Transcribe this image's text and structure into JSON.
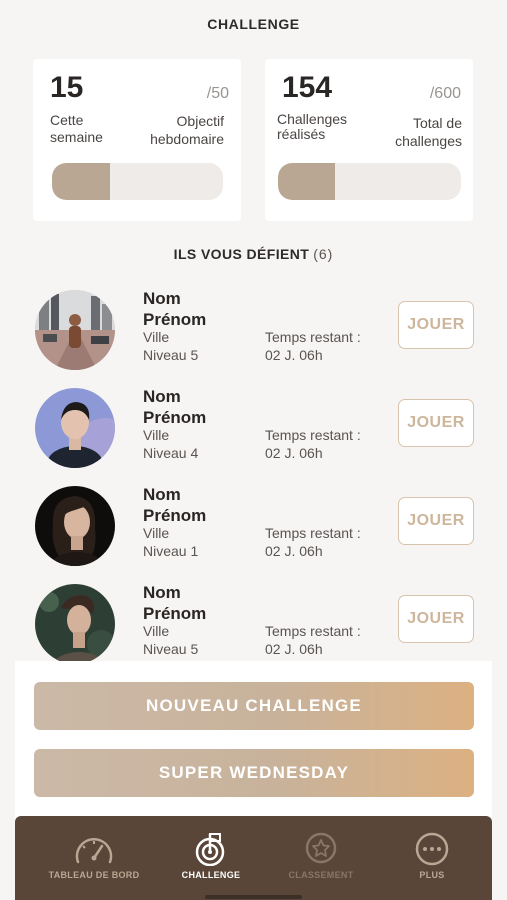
{
  "header": {
    "title": "CHALLENGE"
  },
  "stats": [
    {
      "value": "15",
      "max": "/50",
      "label_left": "Cette\nsemaine",
      "label_right": "Objectif\nhebdomaire",
      "progress": 0.34
    },
    {
      "value": "154",
      "max": "/600",
      "label_left": "Challenges\nréalisés",
      "label_right": "Total de\nchallenges",
      "progress": 0.31
    }
  ],
  "section": {
    "title": "ILS VOUS DÉFIENT",
    "count": "(6)"
  },
  "challengers": [
    {
      "name": "Nom\nPrénom",
      "city": "Ville",
      "level": "Niveau 5",
      "time_label": "Temps restant :",
      "time_value": "02 J. 06h",
      "play_label": "JOUER"
    },
    {
      "name": "Nom\nPrénom",
      "city": "Ville",
      "level": "Niveau 4",
      "time_label": "Temps restant :",
      "time_value": "02 J. 06h",
      "play_label": "JOUER"
    },
    {
      "name": "Nom\nPrénom",
      "city": "Ville",
      "level": "Niveau 1",
      "time_label": "Temps restant :",
      "time_value": "02 J. 06h",
      "play_label": "JOUER"
    },
    {
      "name": "Nom\nPrénom",
      "city": "Ville",
      "level": "Niveau 5",
      "time_label": "Temps restant :",
      "time_value": "02 J. 06h",
      "play_label": "JOUER"
    }
  ],
  "actions": {
    "new_challenge": "NOUVEAU CHALLENGE",
    "super_wednesday": "SUPER WEDNESDAY"
  },
  "tabs": [
    {
      "label": "TABLEAU DE BORD",
      "icon": "speedometer-icon"
    },
    {
      "label": "CHALLENGE",
      "icon": "target-flag-icon"
    },
    {
      "label": "CLASSEMENT",
      "icon": "star-badge-icon"
    },
    {
      "label": "PLUS",
      "icon": "more-dots-icon"
    }
  ],
  "colors": {
    "accent": "#b9a794",
    "tabbar": "#5a4638",
    "button_gradient_end": "#dcb182"
  }
}
